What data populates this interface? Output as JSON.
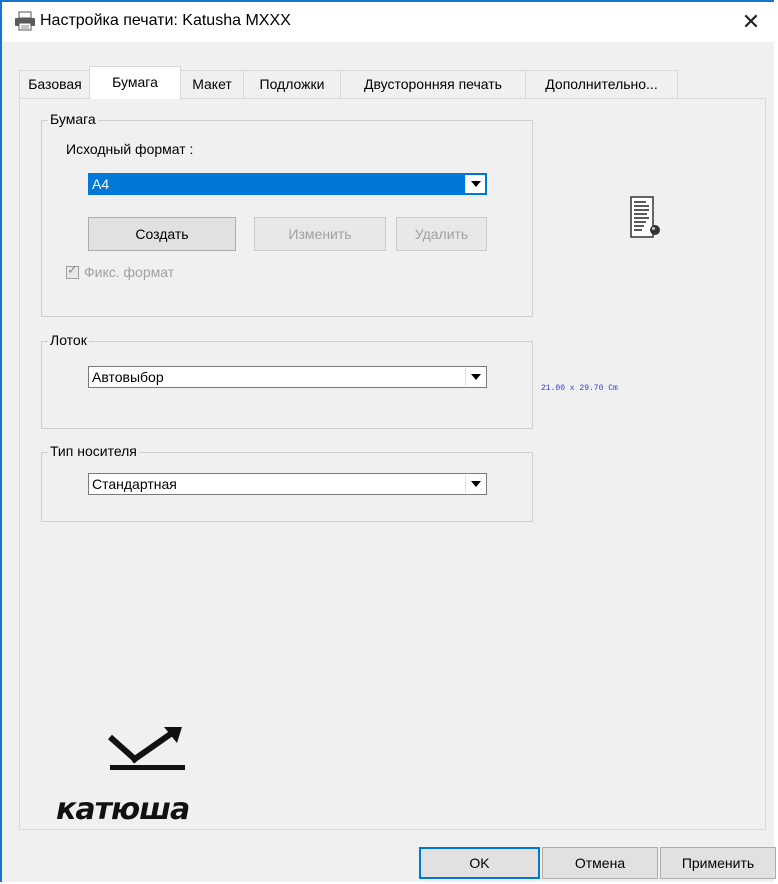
{
  "window": {
    "title": "Настройка печати: Katusha MXXX",
    "close_label": "✕"
  },
  "tabs": [
    {
      "label": "Базовая"
    },
    {
      "label": "Бумага"
    },
    {
      "label": "Макет"
    },
    {
      "label": "Подложки"
    },
    {
      "label": "Двусторонняя печать"
    },
    {
      "label": "Дополнительно..."
    }
  ],
  "paper_group": {
    "legend": "Бумага",
    "source_format_label": "Исходный формат :",
    "source_format_value": "A4",
    "create_label": "Создать",
    "edit_label": "Изменить",
    "delete_label": "Удалить",
    "fixed_format_label": "Фикс. формат"
  },
  "tray_group": {
    "legend": "Лоток",
    "value": "Автовыбор"
  },
  "media_group": {
    "legend": "Тип носителя",
    "value": "Стандартная"
  },
  "preview": {
    "dimensions": "21.00 x 29.70 Cm"
  },
  "logo": {
    "text": "катюша"
  },
  "footer": {
    "ok_label": "OK",
    "cancel_label": "Отмена",
    "apply_label": "Применить"
  },
  "colors": {
    "accent": "#0078d7",
    "window_border": "#1a73d1"
  }
}
